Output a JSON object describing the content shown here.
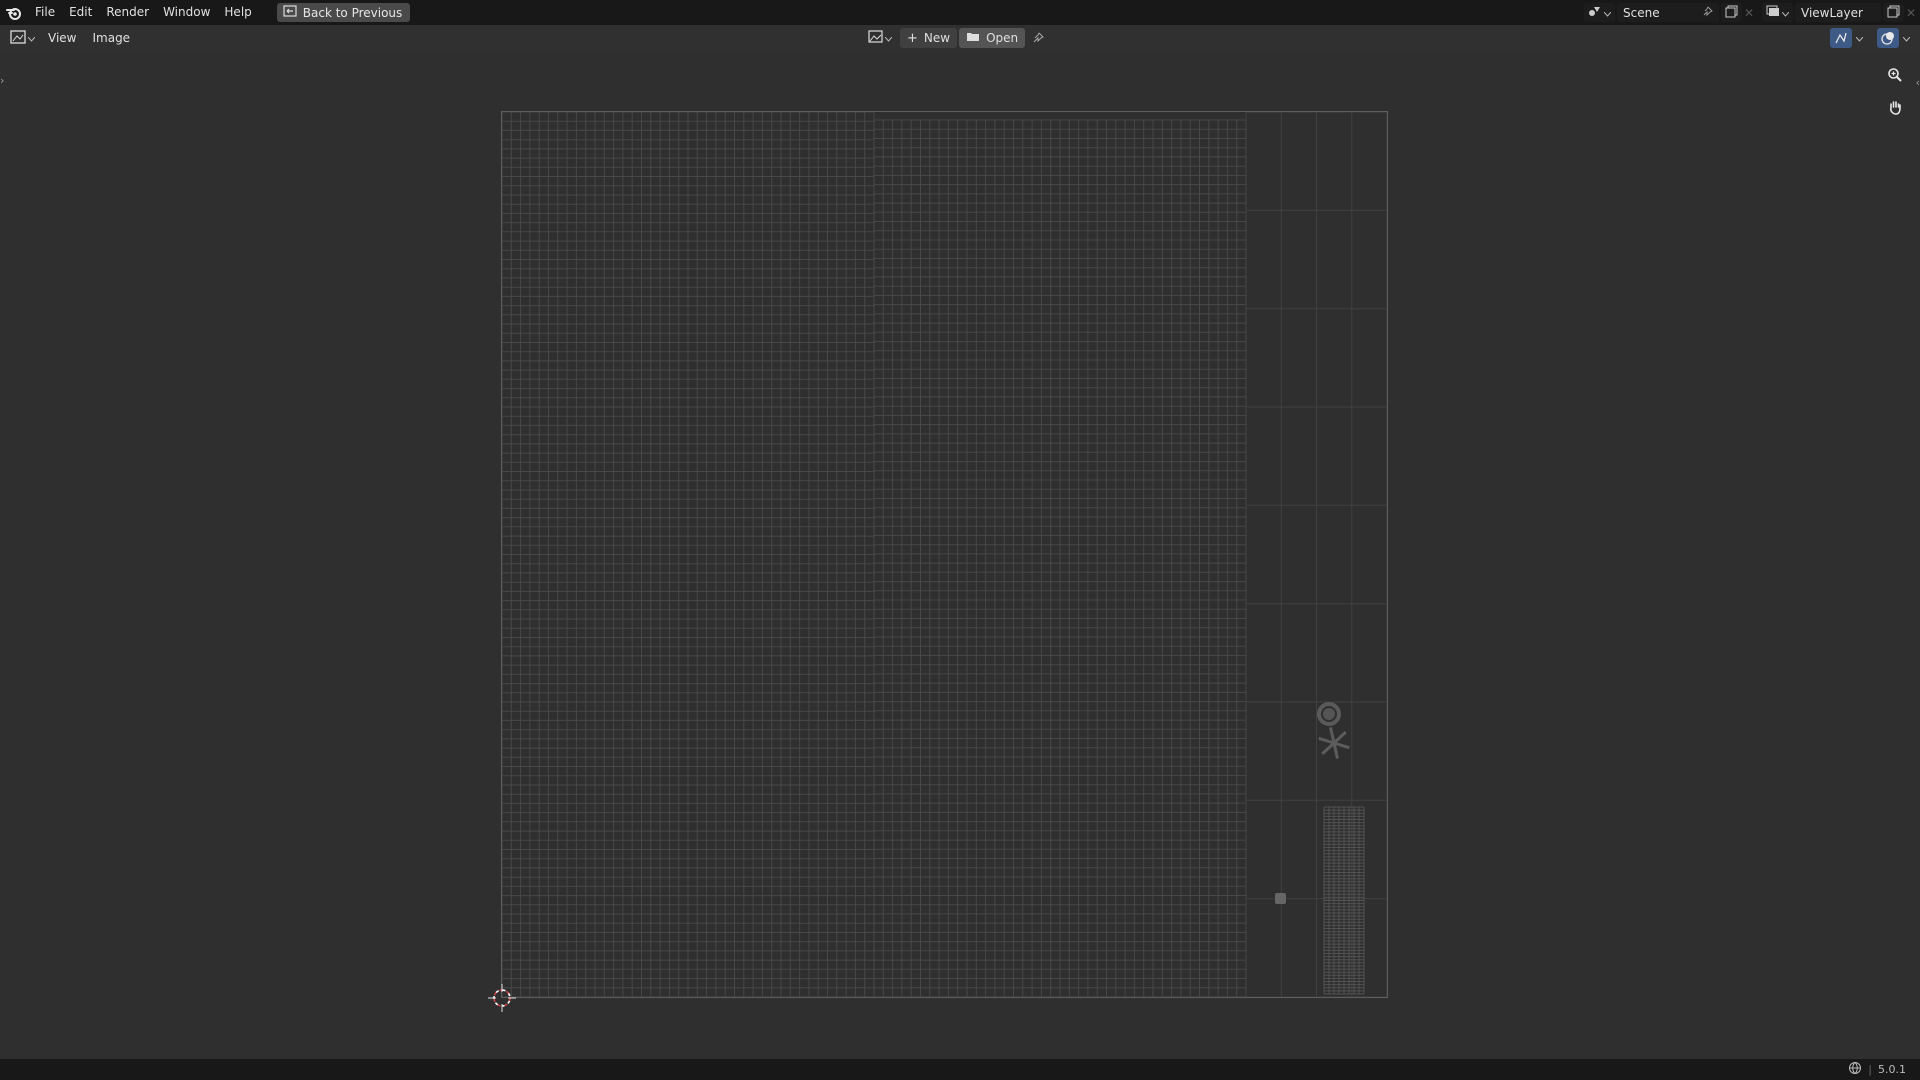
{
  "menubar": {
    "items": [
      "File",
      "Edit",
      "Render",
      "Window",
      "Help"
    ],
    "back_label": "Back to Previous"
  },
  "topright": {
    "scene_name": "Scene",
    "viewlayer_name": "ViewLayer"
  },
  "header": {
    "menus": [
      "View",
      "Image"
    ],
    "new_label": "New",
    "open_label": "Open"
  },
  "status": {
    "version": "5.0.1"
  },
  "colors": {
    "accent_blue": "#3d5b86",
    "grid_line": "#4a4a4a",
    "frame": "#5e5e5e",
    "cursor_red": "#d04040"
  }
}
